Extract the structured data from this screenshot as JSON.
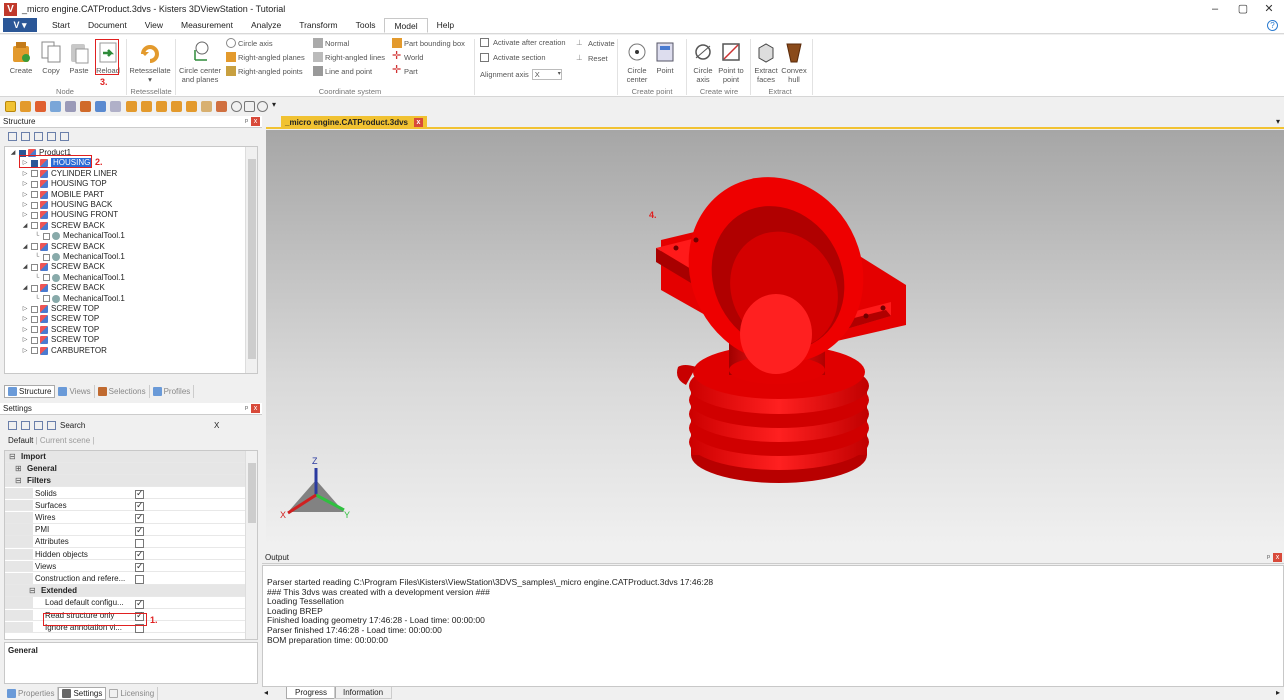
{
  "window": {
    "title": "_micro engine.CATProduct.3dvs - Kisters 3DViewStation - Tutorial",
    "controls": [
      "–",
      "▢",
      "✕"
    ]
  },
  "menu": {
    "app_button": "V",
    "tabs": [
      "Start",
      "Document",
      "View",
      "Measurement",
      "Analyze",
      "Transform",
      "Tools",
      "Model",
      "Help"
    ],
    "active_tab": "Model",
    "help_icon": "?"
  },
  "ribbon": {
    "node": {
      "create": "Create",
      "copy": "Copy",
      "paste": "Paste",
      "reload": "Reload",
      "group": "Node"
    },
    "retessellate": {
      "label": "Retessellate",
      "arrow": "▾",
      "group": "Retessellate"
    },
    "coord": {
      "circle_center_line1": "Circle center",
      "circle_center_line2": "and planes",
      "circle_axis": "Circle axis",
      "right_angled_planes": "Right-angled planes",
      "right_angled_points": "Right-angled points",
      "normal": "Normal",
      "right_angled_lines": "Right-angled lines",
      "line_and_point": "Line and point",
      "part_bounding_box": "Part bounding box",
      "world": "World",
      "part": "Part",
      "group": "Coordinate system"
    },
    "activate": {
      "activate_after_creation": "Activate after creation",
      "activate_section": "Activate section",
      "alignment_axis": "Alignment axis",
      "alignment_value": "X",
      "activate": "Activate",
      "reset": "Reset"
    },
    "create_point": {
      "circle_center_line1": "Circle",
      "circle_center_line2": "center",
      "point": "Point",
      "group": "Create point"
    },
    "create_wire": {
      "circle_axis_line1": "Circle",
      "circle_axis_line2": "axis",
      "point_to_point_line1": "Point to",
      "point_to_point_line2": "point",
      "group": "Create wire"
    },
    "extract": {
      "extract_faces_line1": "Extract",
      "extract_faces_line2": "faces",
      "convex_hull_line1": "Convex",
      "convex_hull_line2": "hull",
      "group": "Extract"
    }
  },
  "annotations": {
    "a1": "1.",
    "a2": "2.",
    "a3": "3.",
    "a4": "4."
  },
  "structure_panel": {
    "title": "Structure",
    "pin": "ᵖ",
    "close": "x",
    "tree": [
      {
        "label": "Product1",
        "level": 0,
        "kind": "product",
        "expanded": true
      },
      {
        "label": "HOUSING",
        "level": 1,
        "kind": "part",
        "selected": true
      },
      {
        "label": "CYLINDER LINER",
        "level": 1,
        "kind": "part"
      },
      {
        "label": "HOUSING TOP",
        "level": 1,
        "kind": "part"
      },
      {
        "label": "MOBILE PART",
        "level": 1,
        "kind": "part"
      },
      {
        "label": "HOUSING BACK",
        "level": 1,
        "kind": "part"
      },
      {
        "label": "HOUSING FRONT",
        "level": 1,
        "kind": "part"
      },
      {
        "label": "SCREW BACK",
        "level": 1,
        "kind": "part",
        "expanded": true
      },
      {
        "label": "MechanicalTool.1",
        "level": 2,
        "kind": "tool"
      },
      {
        "label": "SCREW BACK",
        "level": 1,
        "kind": "part",
        "expanded": true
      },
      {
        "label": "MechanicalTool.1",
        "level": 2,
        "kind": "tool"
      },
      {
        "label": "SCREW BACK",
        "level": 1,
        "kind": "part",
        "expanded": true
      },
      {
        "label": "MechanicalTool.1",
        "level": 2,
        "kind": "tool"
      },
      {
        "label": "SCREW BACK",
        "level": 1,
        "kind": "part",
        "expanded": true
      },
      {
        "label": "MechanicalTool.1",
        "level": 2,
        "kind": "tool"
      },
      {
        "label": "SCREW TOP",
        "level": 1,
        "kind": "part"
      },
      {
        "label": "SCREW TOP",
        "level": 1,
        "kind": "part"
      },
      {
        "label": "SCREW TOP",
        "level": 1,
        "kind": "part"
      },
      {
        "label": "SCREW TOP",
        "level": 1,
        "kind": "part"
      },
      {
        "label": "CARBURETOR",
        "level": 1,
        "kind": "part"
      }
    ],
    "tabs": [
      "Structure",
      "Views",
      "Selections",
      "Profiles"
    ]
  },
  "settings_panel": {
    "title": "Settings",
    "search": "Search",
    "clear": "X",
    "profiles": [
      "Default",
      "Current scene"
    ],
    "rows": [
      {
        "label": "Import",
        "type": "cat",
        "expander": "⊟"
      },
      {
        "label": "General",
        "type": "sub",
        "expander": "⊞"
      },
      {
        "label": "Filters",
        "type": "sub",
        "expander": "⊟"
      },
      {
        "label": "Solids",
        "type": "bool",
        "value": true
      },
      {
        "label": "Surfaces",
        "type": "bool",
        "value": true
      },
      {
        "label": "Wires",
        "type": "bool",
        "value": true
      },
      {
        "label": "PMI",
        "type": "bool",
        "value": true
      },
      {
        "label": "Attributes",
        "type": "bool",
        "value": false
      },
      {
        "label": "Hidden objects",
        "type": "bool",
        "value": true
      },
      {
        "label": "Views",
        "type": "bool",
        "value": true
      },
      {
        "label": "Construction and refere...",
        "type": "bool",
        "value": false
      },
      {
        "label": "Extended",
        "type": "sub2",
        "expander": "⊟"
      },
      {
        "label": "Load default configu...",
        "type": "bool2",
        "value": true
      },
      {
        "label": "Read structure only",
        "type": "bool2",
        "value": true
      },
      {
        "label": "Ignore annotation vi...",
        "type": "bool2",
        "value": false
      }
    ],
    "description_title": "General",
    "tabs": [
      "Properties",
      "Settings",
      "Licensing"
    ]
  },
  "viewport": {
    "tab_title": "_micro engine.CATProduct.3dvs",
    "tab_close": "x",
    "axes": {
      "x": "X",
      "y": "Y",
      "z": "Z"
    },
    "model_color": "#ff0000"
  },
  "output_panel": {
    "title": "Output",
    "lines": [
      "Parser started reading C:\\Program Files\\Kisters\\ViewStation\\3DVS_samples\\_micro engine.CATProduct.3dvs 17:46:28",
      "### This 3dvs was created with a development version ###",
      "Loading Tessellation",
      "Loading BREP",
      "Finished loading geometry 17:46:28 - Load time: 00:00:00",
      "Parser finished 17:46:28 - Load time: 00:00:00",
      "BOM preparation time: 00:00:00"
    ],
    "tabs": [
      "Progress",
      "Information"
    ]
  }
}
